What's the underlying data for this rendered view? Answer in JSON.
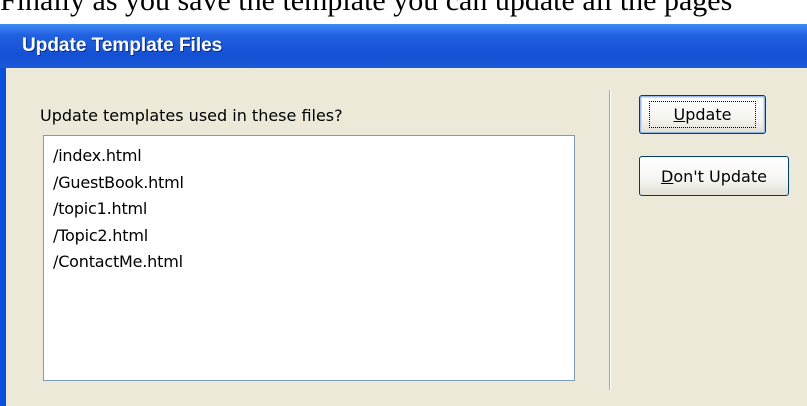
{
  "caption": "Finally as you save the template you can update all the pages",
  "dialog": {
    "title": "Update Template Files",
    "prompt": "Update templates used in these files?",
    "files": [
      "/index.html",
      "/GuestBook.html",
      "/topic1.html",
      "/Topic2.html",
      "/ContactMe.html"
    ],
    "buttons": {
      "update": {
        "mnemonic": "U",
        "rest": "pdate"
      },
      "dont_update": {
        "mnemonic": "D",
        "rest": "on't Update"
      }
    }
  },
  "colors": {
    "title_bar": "#1450d4",
    "dialog_face": "#ece9d8",
    "list_border": "#7f9db9",
    "button_border": "#003c74"
  }
}
